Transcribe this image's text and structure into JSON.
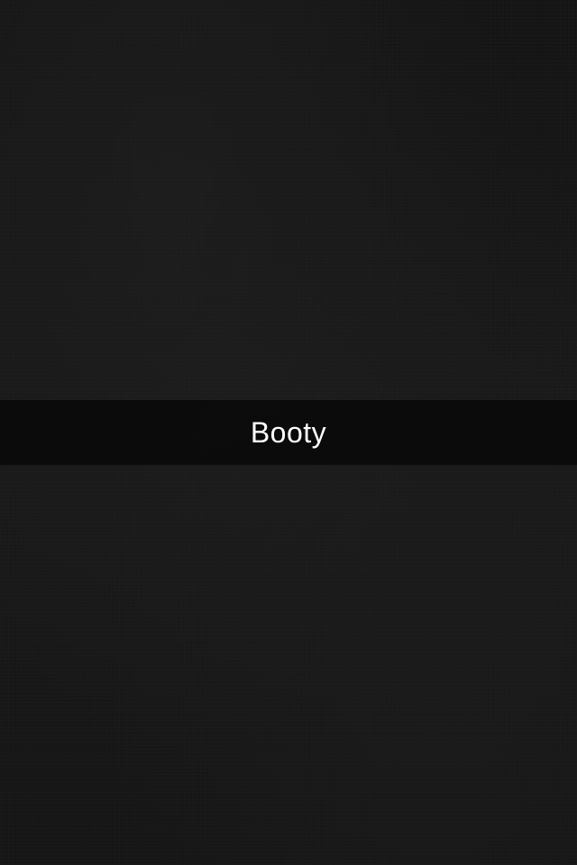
{
  "snap": {
    "caption": "Booty",
    "caption_color": "#ffffff",
    "background_color": "#161616"
  }
}
